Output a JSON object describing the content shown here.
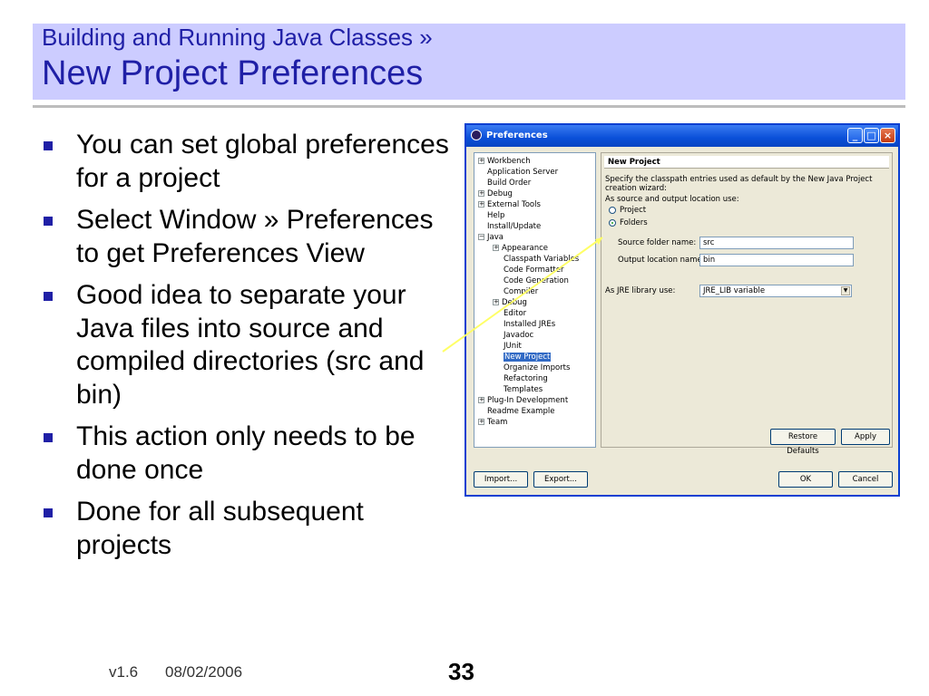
{
  "slide": {
    "header_subtitle": "Building and Running Java Classes »",
    "header_title": "New Project Preferences",
    "bullets": [
      "You can set global preferences for a project",
      "Select Window » Preferences to get Preferences View",
      "Good idea to separate your Java files into source and compiled directories (src and bin)",
      "This action only needs to be done once",
      "Done for all subsequent projects"
    ],
    "footer": {
      "version": "v1.6",
      "date": "08/02/2006",
      "page": "33"
    },
    "colors": {
      "title_band": "#ccccff",
      "title_text": "#1f1fa6",
      "bullet": "#1f1fa6",
      "callout_line": "#ffff66"
    }
  },
  "dialog": {
    "title": "Preferences",
    "window_buttons": [
      "minimize-icon",
      "maximize-icon",
      "close-icon"
    ],
    "tree": [
      "Workbench",
      "Application Server",
      "Build Order",
      "Debug",
      "External Tools",
      "Help",
      "Install/Update",
      "Java",
      "Appearance",
      "Classpath Variables",
      "Code Formatter",
      "Code Generation",
      "Compiler",
      "Debug",
      "Editor",
      "Installed JREs",
      "Javadoc",
      "JUnit",
      "New Project",
      "Organize Imports",
      "Refactoring",
      "Templates",
      "Plug-In Development",
      "Readme Example",
      "Team"
    ],
    "selected_tree_item": "New Project",
    "pane": {
      "header": "New Project",
      "description": "Specify the classpath entries used as default by the New Java Project creation wizard:",
      "location_label": "As source and output location use:",
      "radio_project": "Project",
      "radio_folders": "Folders",
      "selected_radio": "Folders",
      "source_label": "Source folder name:",
      "source_value": "src",
      "output_label": "Output location name:",
      "output_value": "bin",
      "jre_label": "As JRE library use:",
      "jre_value": "JRE_LIB variable"
    },
    "buttons": {
      "restore_defaults": "Restore Defaults",
      "apply": "Apply",
      "import": "Import...",
      "export": "Export...",
      "ok": "OK",
      "cancel": "Cancel"
    }
  }
}
